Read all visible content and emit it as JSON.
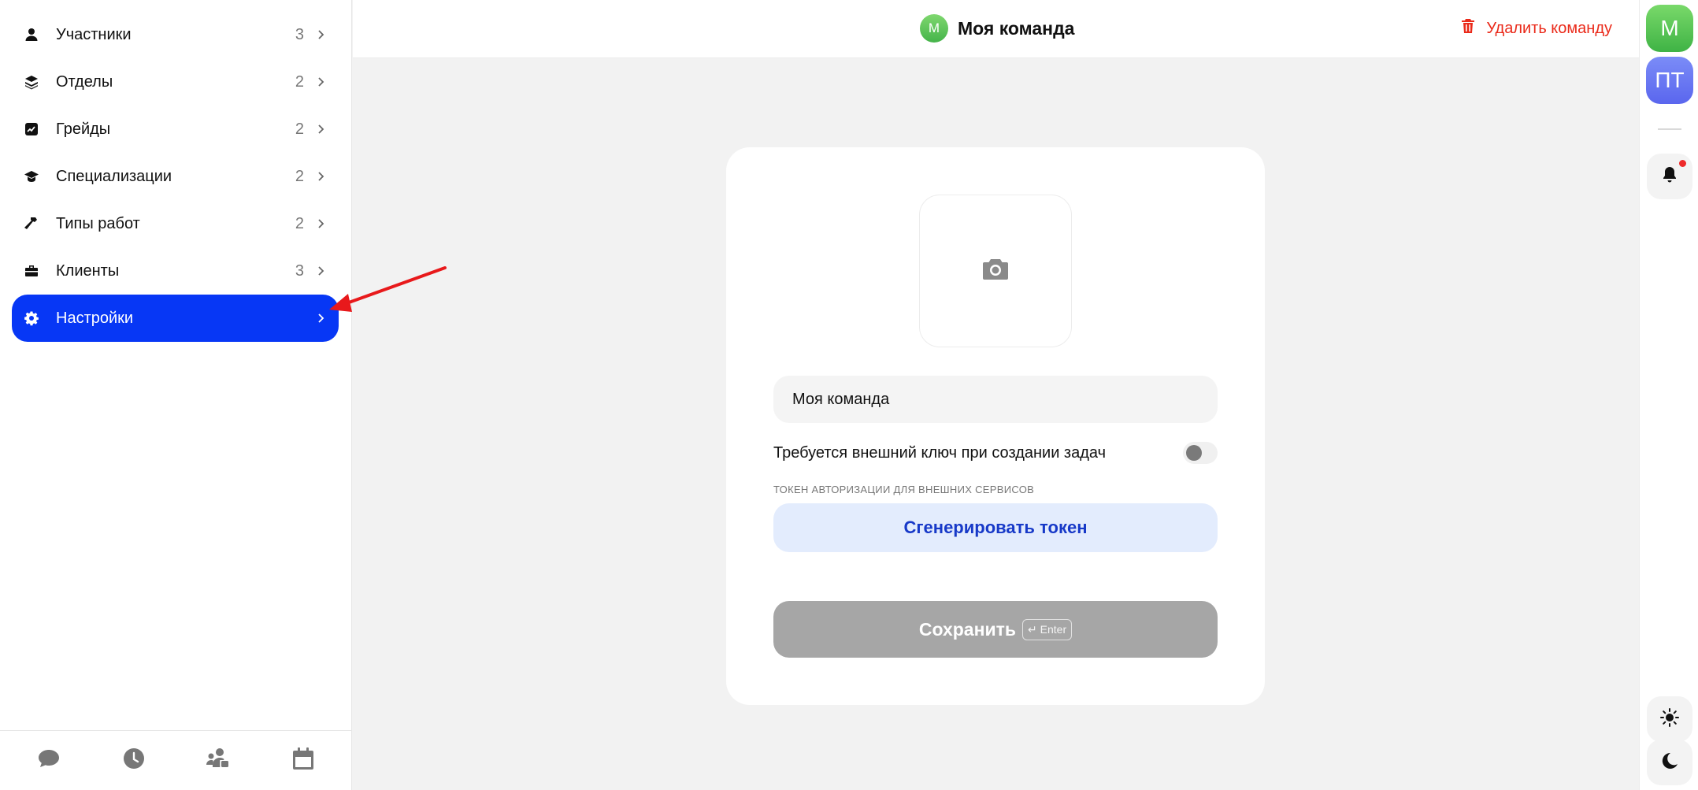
{
  "sidebar": {
    "items": [
      {
        "label": "Участники",
        "count": "3",
        "icon": "user-icon"
      },
      {
        "label": "Отделы",
        "count": "2",
        "icon": "layers-icon"
      },
      {
        "label": "Грейды",
        "count": "2",
        "icon": "chart-icon"
      },
      {
        "label": "Специализации",
        "count": "2",
        "icon": "graduation-cap-icon"
      },
      {
        "label": "Типы работ",
        "count": "2",
        "icon": "hammer-icon"
      },
      {
        "label": "Клиенты",
        "count": "3",
        "icon": "briefcase-icon"
      },
      {
        "label": "Настройки",
        "count": "",
        "icon": "gear-icon",
        "active": true
      }
    ],
    "footer_icons": [
      "chat-icon",
      "clock-icon",
      "team-icon",
      "calendar-icon"
    ]
  },
  "header": {
    "avatar_letter": "М",
    "title": "Моя команда",
    "delete_label": "Удалить команду"
  },
  "form": {
    "team_name_value": "Моя команда",
    "external_key_label": "Требуется внешний ключ при создании задач",
    "external_key_enabled": false,
    "token_caption": "ТОКЕН АВТОРИЗАЦИИ ДЛЯ ВНЕШНИХ СЕРВИСОВ",
    "generate_token_label": "Сгенерировать токен",
    "save_label": "Сохранить",
    "enter_hint": "↵ Enter"
  },
  "rail": {
    "avatars": [
      "М",
      "ПТ"
    ]
  },
  "colors": {
    "accent": "#0737f5",
    "danger": "#ea2a1a",
    "annotation": "#e8191b"
  }
}
